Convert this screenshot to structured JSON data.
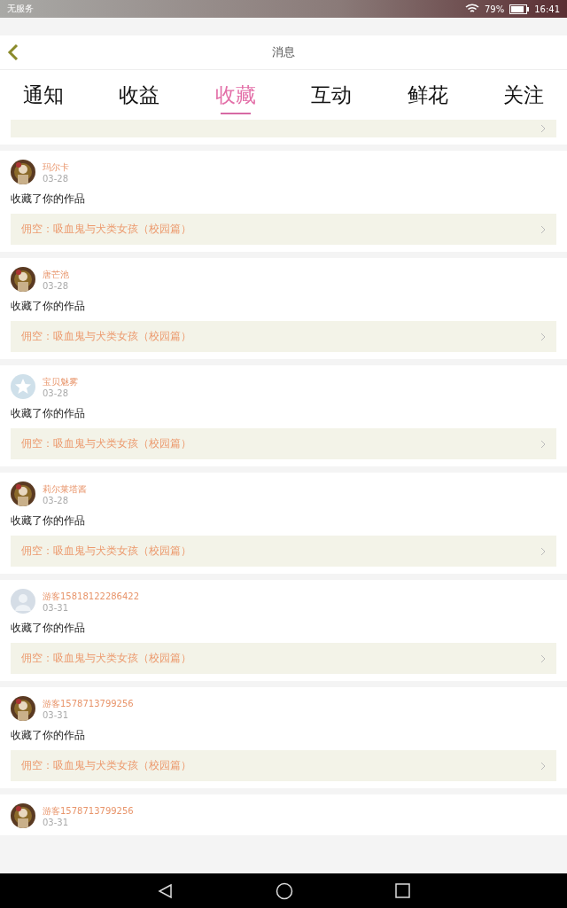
{
  "status_bar": {
    "carrier": "无服务",
    "battery": "79%",
    "time": "16:41"
  },
  "header": {
    "title": "消息"
  },
  "tabs": [
    {
      "label": "通知",
      "selected": false
    },
    {
      "label": "收益",
      "selected": false
    },
    {
      "label": "收藏",
      "selected": true
    },
    {
      "label": "互动",
      "selected": false
    },
    {
      "label": "鲜花",
      "selected": false
    },
    {
      "label": "关注",
      "selected": false
    }
  ],
  "messages": [
    {
      "name": "玛尔卡",
      "date": "03-28",
      "action": "收藏了你的作品",
      "work": "佣空：吸血鬼与犬类女孩（校园篇）"
    },
    {
      "name": "唐芒池",
      "date": "03-28",
      "action": "收藏了你的作品",
      "work": "佣空：吸血鬼与犬类女孩（校园篇）"
    },
    {
      "name": "宝贝魅雾",
      "date": "03-28",
      "action": "收藏了你的作品",
      "work": "佣空：吸血鬼与犬类女孩（校园篇）",
      "avatar": {
        "kind": "star"
      }
    },
    {
      "name": "莉尔莱塔酱",
      "date": "03-28",
      "action": "收藏了你的作品",
      "work": "佣空：吸血鬼与犬类女孩（校园篇）"
    },
    {
      "name": "游客15818122286422",
      "date": "03-31",
      "action": "收藏了你的作品",
      "work": "佣空：吸血鬼与犬类女孩（校园篇）",
      "avatar": {
        "kind": "silhouette"
      }
    },
    {
      "name": "游客1578713799256",
      "date": "03-31",
      "action": "收藏了你的作品",
      "work": "佣空：吸血鬼与犬类女孩（校园篇）"
    },
    {
      "name": "游客1578713799256",
      "date": "03-31"
    }
  ]
}
